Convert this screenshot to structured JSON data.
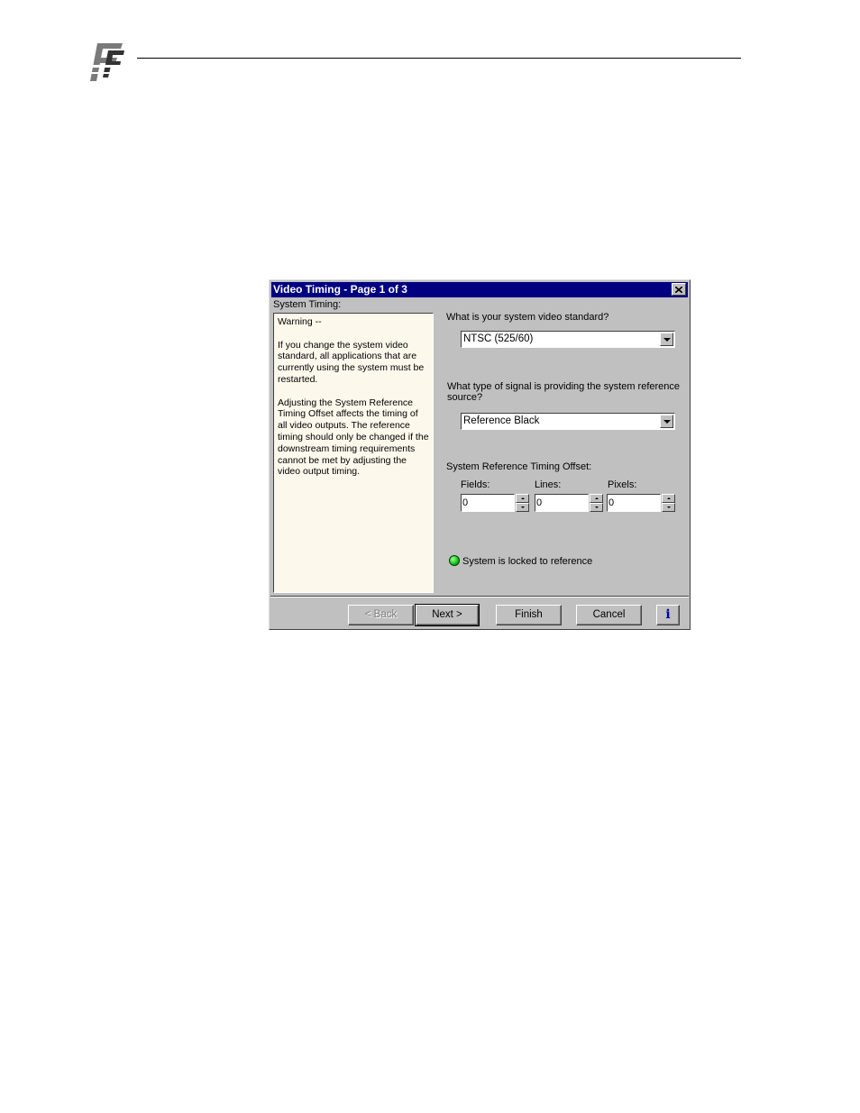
{
  "dialog": {
    "title": "Video Timing - Page 1 of 3",
    "section_label": "System Timing:",
    "warning_heading": "Warning --",
    "warning_p1": "If you change the system video standard, all applications that are currently using the system must be restarted.",
    "warning_p2": "Adjusting the System Reference Timing Offset affects the timing of all video outputs.  The reference timing should only be changed if the downstream timing requirements cannot be met by adjusting the video output timing.",
    "video_standard_question": "What is your system video standard?",
    "video_standard_value": "NTSC (525/60)",
    "reference_question_line1": "What type of signal is providing the system reference",
    "reference_question_line2": "source?",
    "reference_value": "Reference Black",
    "offset_label": "System Reference Timing Offset:",
    "fields_label": "Fields:",
    "lines_label": "Lines:",
    "pixels_label": "Pixels:",
    "fields_value": "0",
    "lines_value": "0",
    "pixels_value": "0",
    "lock_status": "System is locked to reference",
    "lock_color": "#10c010",
    "title_color": "#000080"
  },
  "buttons": {
    "back": "< Back",
    "next": "Next >",
    "finish": "Finish",
    "cancel": "Cancel",
    "info": "i"
  }
}
